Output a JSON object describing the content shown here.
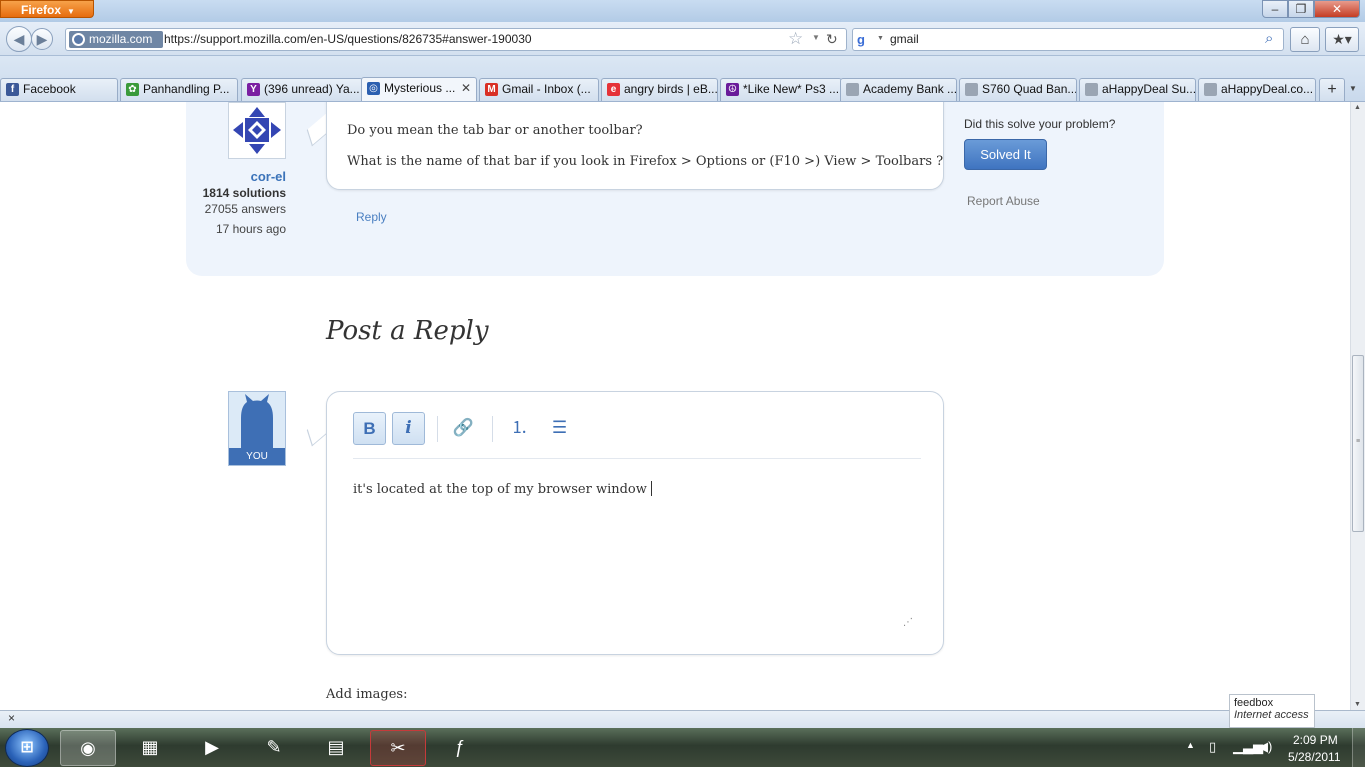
{
  "window": {
    "app_button": "Firefox",
    "min": "–",
    "max": "❐",
    "close": "✕"
  },
  "nav": {
    "back": "◀",
    "forward": "▶",
    "site_identity": "mozilla.com",
    "url": "https://support.mozilla.com/en-US/questions/826735#answer-190030",
    "search_value": "gmail",
    "search_engine_glyph": "g"
  },
  "tabs": [
    {
      "label": "Facebook",
      "icon_color": "#3b5998",
      "glyph": "f"
    },
    {
      "label": "Panhandling P...",
      "icon_color": "#3a9a3a",
      "glyph": "✿"
    },
    {
      "label": "(396 unread) Ya...",
      "icon_color": "#7b1fa2",
      "glyph": "Y"
    },
    {
      "label": "Mysterious ...",
      "icon_color": "#2b5fb0",
      "glyph": "◎",
      "active": true
    },
    {
      "label": "Gmail - Inbox (...",
      "icon_color": "#d93025",
      "glyph": "M"
    },
    {
      "label": "angry birds | eB...",
      "icon_color": "#e53238",
      "glyph": "e"
    },
    {
      "label": "*Like New* Ps3 ...",
      "icon_color": "#6a1b9a",
      "glyph": "☮"
    },
    {
      "label": "Academy Bank ...",
      "icon_color": "#9aa5b3",
      "glyph": ""
    },
    {
      "label": "S760 Quad Ban...",
      "icon_color": "#9aa5b3",
      "glyph": ""
    },
    {
      "label": "aHappyDeal Su...",
      "icon_color": "#9aa5b3",
      "glyph": ""
    },
    {
      "label": "aHappyDeal.co...",
      "icon_color": "#9aa5b3",
      "glyph": ""
    }
  ],
  "answer": {
    "author": "cor-el",
    "solutions": "1814 solutions",
    "answers": "27055 answers",
    "time_ago": "17 hours ago",
    "line1": "Do you mean the tab bar or another toolbar?",
    "line2": "What is the name of that bar if you look in Firefox > Options or (F10 >) View > Toolbars ?",
    "reply": "Reply",
    "solve_question": "Did this solve your problem?",
    "solved_button": "Solved It",
    "report": "Report Abuse"
  },
  "reply_form": {
    "title": "Post a Reply",
    "you_label": "YOU",
    "bold": "B",
    "italic": "i",
    "link_icon": "🔗",
    "ol_icon": "⒈",
    "ul_icon": "☰",
    "text": "it's located at the top of my browser window",
    "add_images": "Add images:"
  },
  "status": {
    "close": "×",
    "feedbox_title": "feedbox",
    "feedbox_sub": "Internet access"
  },
  "taskbar": {
    "apps": [
      {
        "name": "firefox",
        "glyph": "◉",
        "active": true
      },
      {
        "name": "explorer",
        "glyph": "▦"
      },
      {
        "name": "media",
        "glyph": "▶"
      },
      {
        "name": "paint",
        "glyph": "✎"
      },
      {
        "name": "calculator",
        "glyph": "▤"
      },
      {
        "name": "snipping",
        "glyph": "✂",
        "hot": true
      },
      {
        "name": "app",
        "glyph": "ƒ"
      }
    ],
    "time": "2:09 PM",
    "date": "5/28/2011"
  }
}
